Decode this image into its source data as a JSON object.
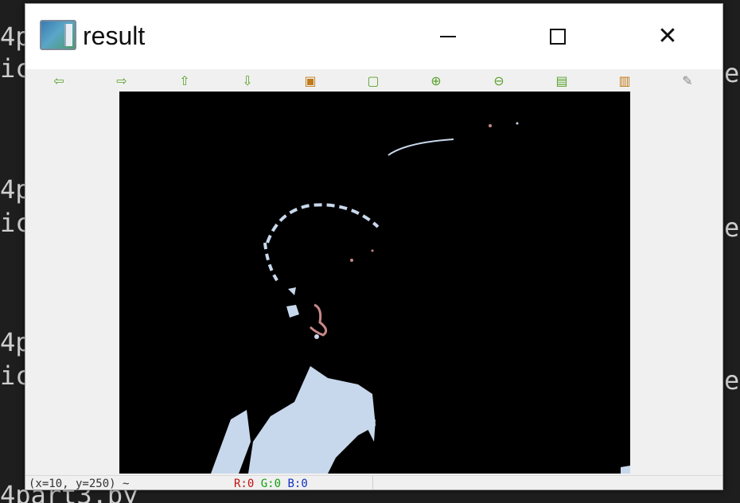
{
  "background_terminal": {
    "left_lines": [
      "4p",
      "ic",
      "",
      "",
      "4p",
      "ic",
      "",
      "",
      "4p",
      "ic"
    ],
    "right_lines": [
      "e",
      "e",
      "e"
    ],
    "bottom_text": "4part3.py"
  },
  "window": {
    "title": "result",
    "title_icon": "image-viewer-app-icon",
    "controls": {
      "minimize_icon": "minimize-icon",
      "maximize_icon": "maximize-icon",
      "close_icon": "close-icon"
    }
  },
  "toolbar": {
    "buttons": [
      {
        "name": "pan-left-button",
        "icon": "arrow-left-icon",
        "glyph": "⇦"
      },
      {
        "name": "pan-right-button",
        "icon": "arrow-right-icon",
        "glyph": "⇨"
      },
      {
        "name": "pan-up-button",
        "icon": "arrow-up-icon",
        "glyph": "⇧"
      },
      {
        "name": "pan-down-button",
        "icon": "arrow-down-icon",
        "glyph": "⇩"
      },
      {
        "name": "zoom-fit-button",
        "icon": "image-icon",
        "glyph": "▣"
      },
      {
        "name": "zoom-original-button",
        "icon": "zoom-image-icon",
        "glyph": "▢"
      },
      {
        "name": "zoom-in-button",
        "icon": "zoom-in-icon",
        "glyph": "⊕"
      },
      {
        "name": "zoom-out-button",
        "icon": "zoom-out-icon",
        "glyph": "⊖"
      },
      {
        "name": "save-button",
        "icon": "save-icon",
        "glyph": "▤"
      },
      {
        "name": "copy-button",
        "icon": "clipboard-icon",
        "glyph": "▥"
      },
      {
        "name": "properties-button",
        "icon": "brush-icon",
        "glyph": "✎"
      }
    ],
    "colors": {
      "green": "#58a22a",
      "orange": "#c07a18",
      "gray": "#888888"
    }
  },
  "statusbar": {
    "coords_text": "(x=10, y=250) ~",
    "r_text": "R:0",
    "g_text": "G:0",
    "b_text": "B:0"
  },
  "image": {
    "description_colors": {
      "background": "#000000",
      "foreground": "#c8d8ec",
      "accent": "#c88888"
    }
  }
}
